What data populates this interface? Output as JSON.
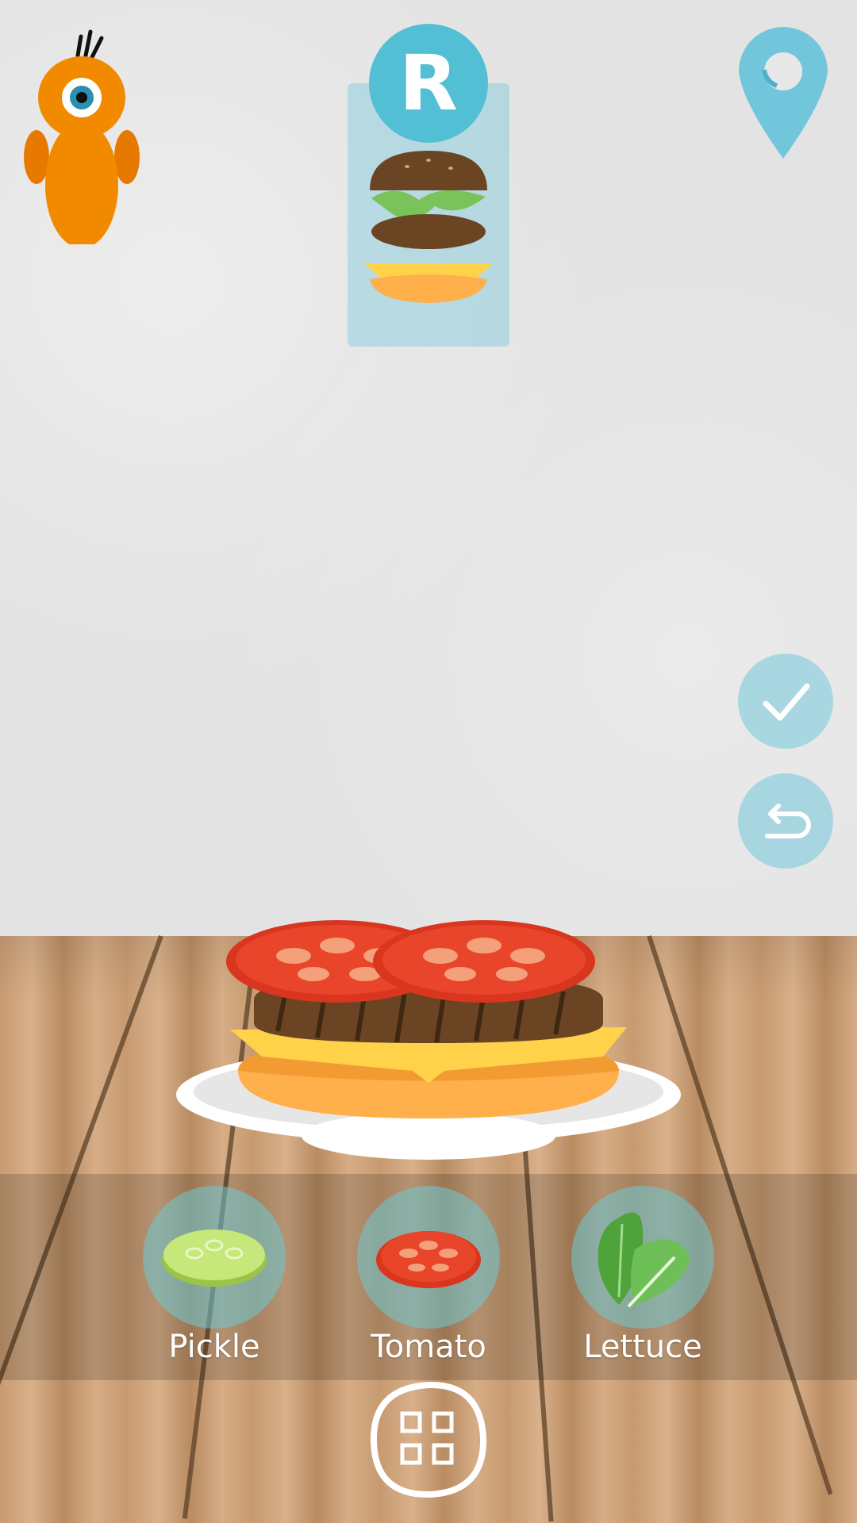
{
  "top_bar": {
    "recipe_badge_letter": "R"
  },
  "ingredients": [
    {
      "label": "Pickle",
      "icon": "pickle-icon"
    },
    {
      "label": "Tomato",
      "icon": "tomato-icon"
    },
    {
      "label": "Lettuce",
      "icon": "lettuce-icon"
    }
  ],
  "actions": {
    "confirm_icon": "checkmark-icon",
    "undo_icon": "undo-icon",
    "menu_icon": "grid-menu-icon",
    "location_icon": "map-pin-icon"
  },
  "colors": {
    "accent": "#52bfd4",
    "mascot": "#f28a00",
    "bun": "#ffb04a",
    "cheese": "#ffd24a",
    "patty": "#6b4423",
    "tomato": "#e8452a",
    "pickle": "#c6e87a",
    "lettuce": "#6fbf58"
  }
}
